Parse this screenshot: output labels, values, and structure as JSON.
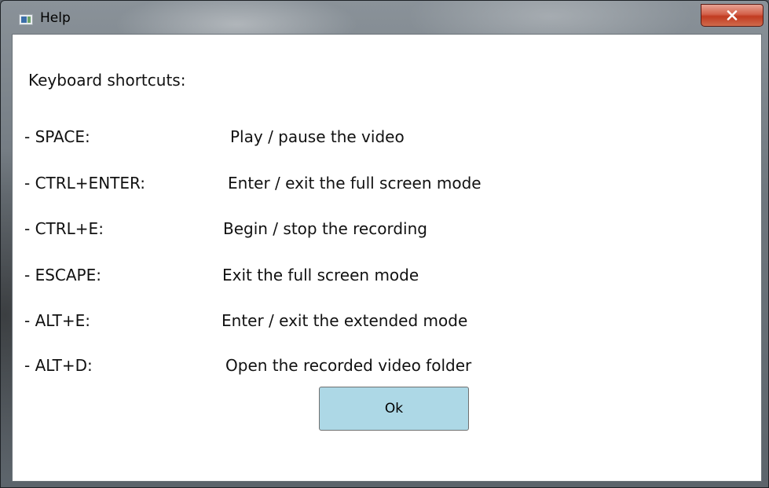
{
  "window": {
    "title": "Help",
    "close_label": "x"
  },
  "content": {
    "heading": "Keyboard shortcuts:",
    "shortcuts": [
      {
        "key": "- SPACE:",
        "description": "Play / pause the video"
      },
      {
        "key": "- CTRL+ENTER:",
        "description": "Enter / exit the full screen mode"
      },
      {
        "key": "- CTRL+E:",
        "description": "Begin / stop the recording"
      },
      {
        "key": "- ESCAPE:",
        "description": "Exit the full screen mode"
      },
      {
        "key": "- ALT+E:",
        "description": "Enter / exit the extended mode"
      },
      {
        "key": "- ALT+D:",
        "description": "Open the recorded video folder"
      }
    ],
    "ok_label": "Ok"
  },
  "colors": {
    "ok_button_bg": "#add8e6",
    "close_button": "#c13b21",
    "client_bg": "#ffffff"
  },
  "icons": {
    "window_icon": "app-window-icon",
    "close_icon": "close-icon"
  }
}
